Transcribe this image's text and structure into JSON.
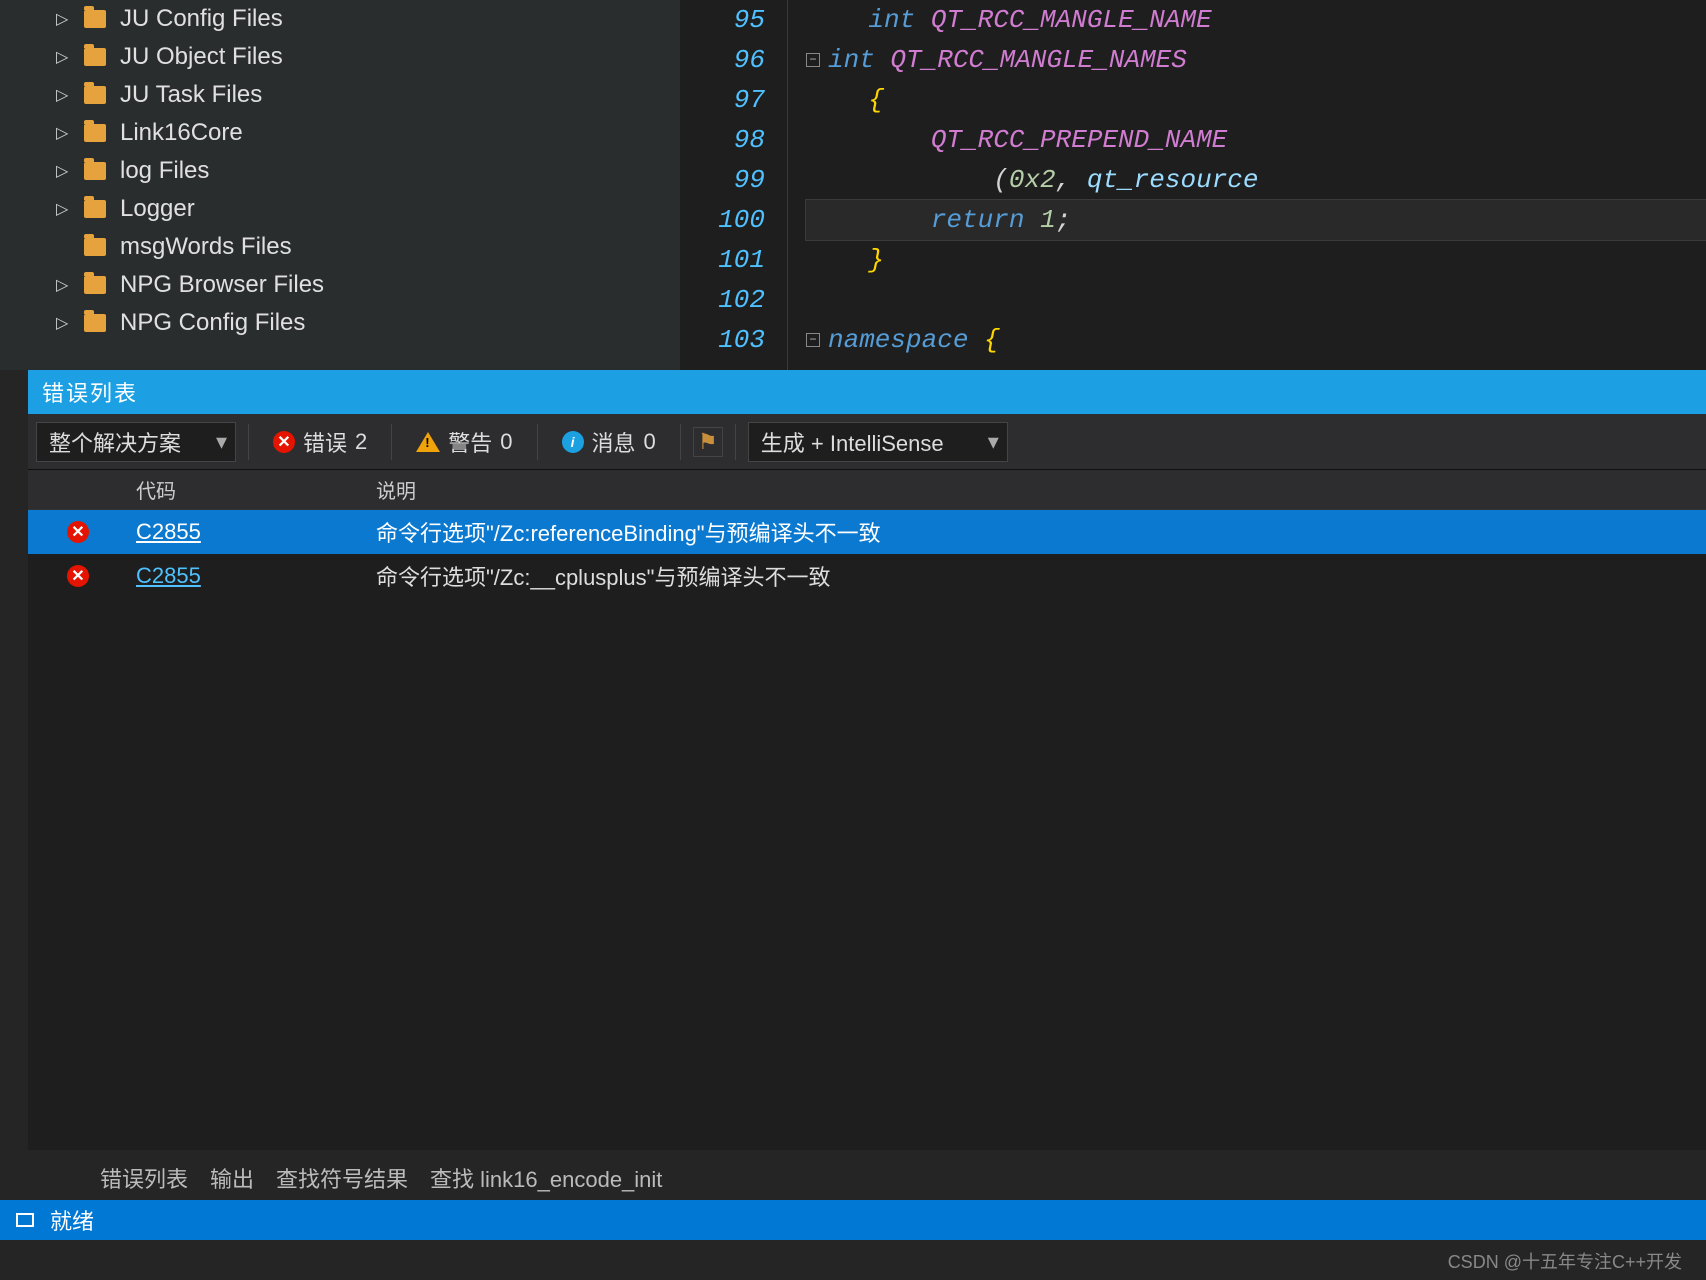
{
  "explorer": {
    "items": [
      {
        "label": "JU Config Files",
        "expandable": true
      },
      {
        "label": "JU Object Files",
        "expandable": true
      },
      {
        "label": "JU Task Files",
        "expandable": true
      },
      {
        "label": "Link16Core",
        "expandable": true
      },
      {
        "label": "log Files",
        "expandable": true
      },
      {
        "label": "Logger",
        "expandable": true
      },
      {
        "label": "msgWords Files",
        "expandable": false
      },
      {
        "label": "NPG Browser Files",
        "expandable": true
      },
      {
        "label": "NPG Config Files",
        "expandable": true
      }
    ]
  },
  "code": {
    "lines": [
      {
        "n": "95",
        "html": "    <span class='kw'>int</span> <span class='macro'>QT_RCC_MANGLE_NAME</span>"
      },
      {
        "n": "96",
        "html": "<span class='fold'>−</span><span class='kw'>int</span> <span class='macro'>QT_RCC_MANGLE_NAMES</span>"
      },
      {
        "n": "97",
        "html": "    <span class='brace'>{</span>"
      },
      {
        "n": "98",
        "html": "        <span class='macro'>QT_RCC_PREPEND_NAME</span>"
      },
      {
        "n": "99",
        "html": "            (<span class='num'>0x2</span>, <span class='ident'>qt_resource</span>"
      },
      {
        "n": "100",
        "html": "        <span class='kw'>return</span> <span class='num'>1</span>;",
        "cursor": true
      },
      {
        "n": "101",
        "html": "    <span class='brace'>}</span>"
      },
      {
        "n": "102",
        "html": ""
      },
      {
        "n": "103",
        "html": "<span class='fold'>−</span><span class='kw'>namespace</span> <span class='brace'>{</span>"
      }
    ]
  },
  "errorPanel": {
    "title": "错误列表",
    "scope": "整个解决方案",
    "errLabel": "错误",
    "errCount": "2",
    "warnLabel": "警告",
    "warnCount": "0",
    "infoLabel": "消息",
    "infoCount": "0",
    "source": "生成 + IntelliSense",
    "headers": {
      "code": "代码",
      "desc": "说明"
    },
    "rows": [
      {
        "code": "C2855",
        "desc": "命令行选项\"/Zc:referenceBinding\"与预编译头不一致",
        "selected": true
      },
      {
        "code": "C2855",
        "desc": "命令行选项\"/Zc:__cplusplus\"与预编译头不一致",
        "selected": false
      }
    ]
  },
  "bottomTabs": [
    "错误列表",
    "输出",
    "查找符号结果",
    "查找 link16_encode_init"
  ],
  "status": {
    "text": "就绪"
  },
  "watermark": "CSDN @十五年专注C++开发"
}
